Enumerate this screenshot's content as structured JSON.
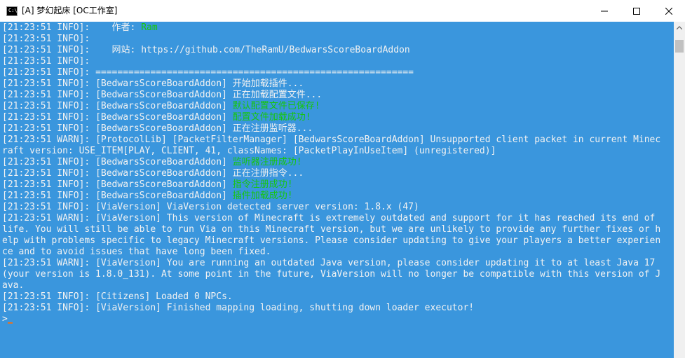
{
  "window": {
    "title": "[A] 梦幻起床 [OC工作室]",
    "icon_name": "console-icon",
    "icon_text": "C:\\",
    "minimize_icon": "minimize-icon",
    "maximize_icon": "maximize-icon",
    "close_icon": "close-icon"
  },
  "colors": {
    "background": "#3a96dd",
    "text": "#f2f2f2",
    "green_text": "#16c60c",
    "cursor": "#e0732a"
  },
  "console": {
    "lines": [
      {
        "prefix": "[21:23:51 INFO]: ",
        "text": "   作者: ",
        "highlight": "Ram"
      },
      {
        "prefix": "[21:23:51 INFO]: ",
        "text": "",
        "highlight": ""
      },
      {
        "prefix": "[21:23:51 INFO]: ",
        "text": "   网站: https://github.com/TheRamU/BedwarsScoreBoardAddon",
        "highlight": ""
      },
      {
        "prefix": "[21:23:51 INFO]: ",
        "text": "",
        "highlight": ""
      },
      {
        "prefix": "[21:23:51 INFO]: ",
        "text": "==========================================================",
        "highlight": ""
      },
      {
        "prefix": "[21:23:51 INFO]: ",
        "text": "[BedwarsScoreBoardAddon] 开始加载插件...",
        "highlight": ""
      },
      {
        "prefix": "[21:23:51 INFO]: ",
        "text": "[BedwarsScoreBoardAddon] 正在加载配置文件...",
        "highlight": ""
      },
      {
        "prefix": "[21:23:51 INFO]: ",
        "text": "[BedwarsScoreBoardAddon] ",
        "highlight": "默认配置文件已保存!"
      },
      {
        "prefix": "[21:23:51 INFO]: ",
        "text": "[BedwarsScoreBoardAddon] ",
        "highlight": "配置文件加载成功!"
      },
      {
        "prefix": "[21:23:51 INFO]: ",
        "text": "[BedwarsScoreBoardAddon] 正在注册监听器...",
        "highlight": ""
      },
      {
        "prefix": "[21:23:51 WARN]: ",
        "text": "[ProtocolLib] [PacketFilterManager] [BedwarsScoreBoardAddon] Unsupported client packet in current Minec",
        "highlight": ""
      },
      {
        "prefix": "",
        "text": "raft version: USE_ITEM[PLAY, CLIENT, 41, classNames: [PacketPlayInUseItem] (unregistered)]",
        "highlight": ""
      },
      {
        "prefix": "[21:23:51 INFO]: ",
        "text": "[BedwarsScoreBoardAddon] ",
        "highlight": "监听器注册成功!"
      },
      {
        "prefix": "[21:23:51 INFO]: ",
        "text": "[BedwarsScoreBoardAddon] 正在注册指令...",
        "highlight": ""
      },
      {
        "prefix": "[21:23:51 INFO]: ",
        "text": "[BedwarsScoreBoardAddon] ",
        "highlight": "指令注册成功!"
      },
      {
        "prefix": "[21:23:51 INFO]: ",
        "text": "[BedwarsScoreBoardAddon] ",
        "highlight": "插件加载成功!"
      },
      {
        "prefix": "[21:23:51 INFO]: ",
        "text": "[ViaVersion] ViaVersion detected server version: 1.8.x (47)",
        "highlight": ""
      },
      {
        "prefix": "[21:23:51 WARN]: ",
        "text": "[ViaVersion] This version of Minecraft is extremely outdated and support for it has reached its end of",
        "highlight": ""
      },
      {
        "prefix": "",
        "text": "life. You will still be able to run Via on this Minecraft version, but we are unlikely to provide any further fixes or h",
        "highlight": ""
      },
      {
        "prefix": "",
        "text": "elp with problems specific to legacy Minecraft versions. Please consider updating to give your players a better experien",
        "highlight": ""
      },
      {
        "prefix": "",
        "text": "ce and to avoid issues that have long been fixed.",
        "highlight": ""
      },
      {
        "prefix": "[21:23:51 WARN]: ",
        "text": "[ViaVersion] You are running an outdated Java version, please consider updating it to at least Java 17",
        "highlight": ""
      },
      {
        "prefix": "",
        "text": "(your version is 1.8.0_131). At some point in the future, ViaVersion will no longer be compatible with this version of J",
        "highlight": ""
      },
      {
        "prefix": "",
        "text": "ava.",
        "highlight": ""
      },
      {
        "prefix": "[21:23:51 INFO]: ",
        "text": "[Citizens] Loaded 0 NPCs.",
        "highlight": ""
      },
      {
        "prefix": "[21:23:51 INFO]: ",
        "text": "[ViaVersion] Finished mapping loading, shutting down loader executor!",
        "highlight": ""
      }
    ],
    "prompt": ">"
  }
}
